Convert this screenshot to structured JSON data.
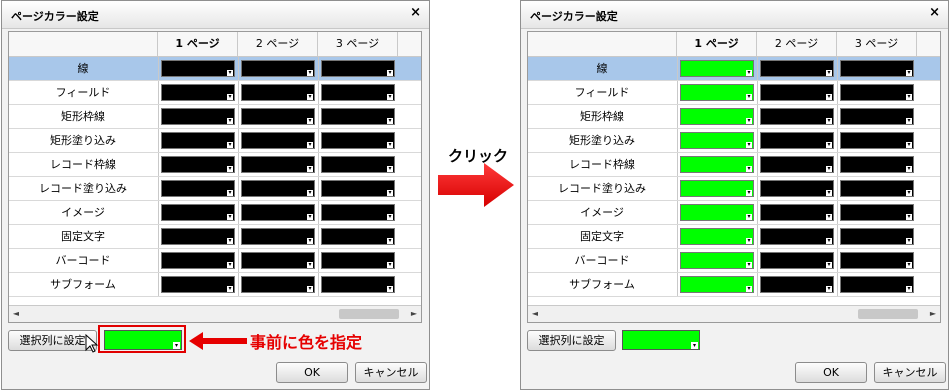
{
  "dialog_title": "ページカラー設定",
  "close_glyph": "×",
  "columns": [
    "1 ページ",
    "2 ページ",
    "3 ページ"
  ],
  "rows": [
    "線",
    "フィールド",
    "矩形枠線",
    "矩形塗り込み",
    "レコード枠線",
    "レコード塗り込み",
    "イメージ",
    "固定文字",
    "バーコード",
    "サブフォーム"
  ],
  "before_colors": [
    "#000000",
    "#000000",
    "#000000"
  ],
  "after_colors": [
    "#00ff00",
    "#000000",
    "#000000"
  ],
  "selected_row": "線",
  "buttons": {
    "set_column": "選択列に設定",
    "ok": "OK",
    "cancel": "キャンセル"
  },
  "picker_color": "#00ff00",
  "scroll": {
    "left": "◄",
    "right": "►"
  },
  "annotations": {
    "click": "クリック",
    "note": "事前に色を指定"
  },
  "colors": {
    "highlight": "#e60000",
    "selected_row": "#a8c7ea"
  }
}
